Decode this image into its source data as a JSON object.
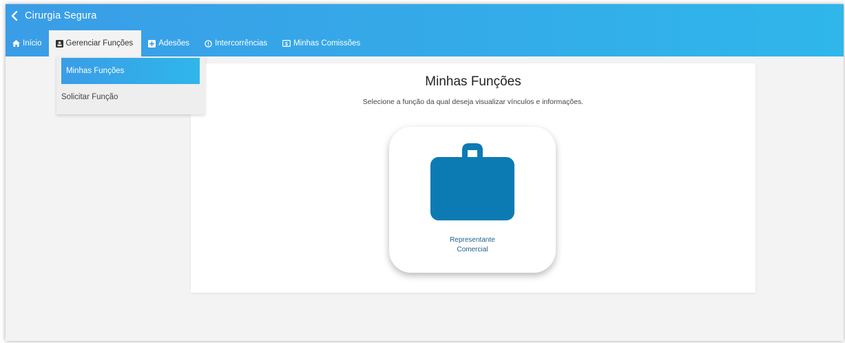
{
  "app": {
    "title": "Cirurgia Segura"
  },
  "tabs": [
    {
      "label": "Início",
      "icon": "home-icon"
    },
    {
      "label": "Gerenciar Funções",
      "icon": "id-card-icon"
    },
    {
      "label": "Adesões",
      "icon": "plus-square-icon"
    },
    {
      "label": "Intercorrências",
      "icon": "alert-circle-icon"
    },
    {
      "label": "Minhas Comissões",
      "icon": "money-icon"
    }
  ],
  "dropdown": {
    "items": [
      {
        "label": "Minhas Funções"
      },
      {
        "label": "Solicitar Função"
      }
    ]
  },
  "main": {
    "title": "Minhas Funções",
    "subtitle": "Selecione a função da qual deseja visualizar vínculos e informações.",
    "roles": [
      {
        "label_line1": "Representante",
        "label_line2": "Comercial",
        "icon": "briefcase-icon"
      }
    ]
  },
  "colors": {
    "header_start": "#3a9de7",
    "header_end": "#2fb6ea",
    "briefcase": "#0c7bb3",
    "role_text": "#1f5f8b"
  }
}
